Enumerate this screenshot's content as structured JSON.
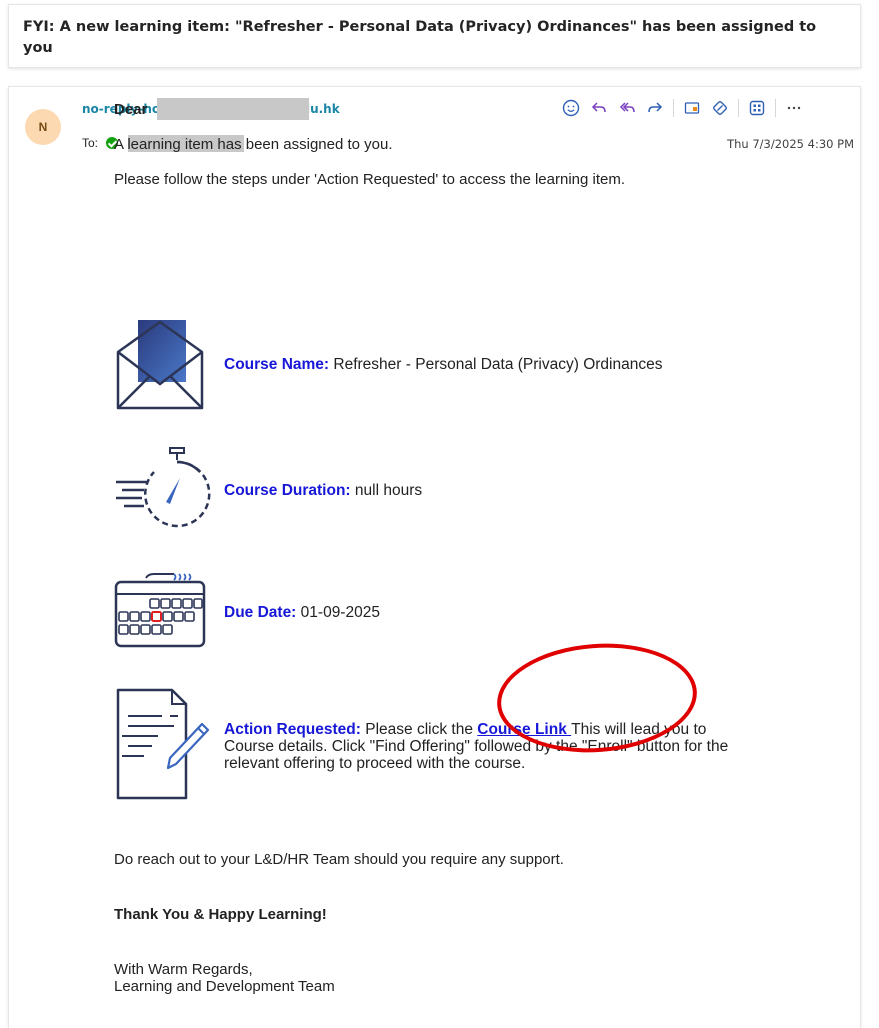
{
  "subject": "FYI: A new learning item: \"Refresher - Personal Data (Privacy) Ordinances\" has been assigned to you",
  "message": {
    "avatar_initial": "N",
    "sender": "no-reply-hcm@cloudsaas.hkbu.edu.hk",
    "to_label": "To:",
    "timestamp": "Thu 7/3/2025 4:30 PM",
    "toolbar_icons": [
      "smiley-icon",
      "reply-icon",
      "reply-all-icon",
      "forward-icon",
      "note-icon",
      "tag-icon",
      "apps-icon",
      "more-icon"
    ]
  },
  "body": {
    "greeting": "Dear",
    "line1": "A  learning item has been assigned to you.",
    "line2": "Please follow the steps under 'Action Requested' to access the learning item.",
    "course_name_label": "Course Name:",
    "course_name_value": " Refresher - Personal Data (Privacy) Ordinances",
    "duration_label": "Course Duration:",
    "duration_value": "  null hours",
    "due_label": "Due Date:",
    "due_value": " 01-09-2025",
    "action_label": "Action Requested:",
    "action_text_1": " Please click the ",
    "course_link": "Course Link ",
    "action_text_2": "This will lead you to Course details. Click \"Find Offering\" followed by the \"Enroll\" button for the relevant offering to proceed with the course.",
    "support": "Do reach out to your L&D/HR Team should you require any support.",
    "thanks": "Thank You & Happy Learning!",
    "regards_1": "With Warm Regards,",
    "regards_2": "Learning and Development Team"
  },
  "colors": {
    "accent_blue": "#1717d8",
    "sender_teal": "#1a86a6",
    "annotation_red": "#e00000",
    "icon_navy": "#2c3556"
  }
}
